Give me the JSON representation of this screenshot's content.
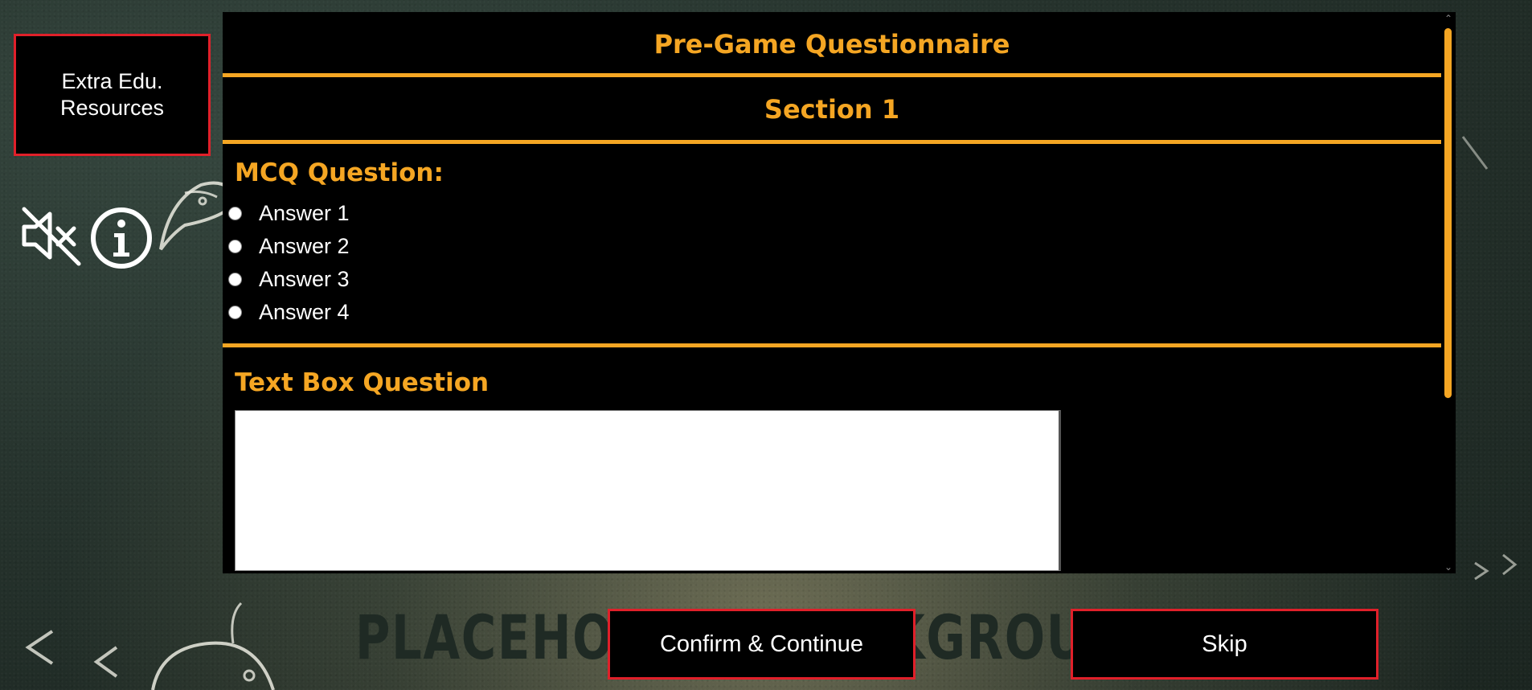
{
  "colors": {
    "accent": "#f5a623",
    "button_border": "#e0202a",
    "panel_bg": "#000000",
    "text": "#ffffff"
  },
  "sidebar": {
    "extra_resources_line1": "Extra Edu.",
    "extra_resources_line2": "Resources",
    "icons": [
      "mute-icon",
      "info-icon"
    ]
  },
  "questionnaire": {
    "title": "Pre-Game Questionnaire",
    "section": "Section 1",
    "mcq": {
      "heading": "MCQ Question:",
      "answers": [
        "Answer 1",
        "Answer 2",
        "Answer 3",
        "Answer 4"
      ]
    },
    "text_question": {
      "heading": "Text Box Question",
      "value": ""
    }
  },
  "background": {
    "placeholder_text": "PLACEHOLDER BACKGROUND IMAGE"
  },
  "actions": {
    "confirm_label": "Confirm & Continue",
    "skip_label": "Skip"
  }
}
